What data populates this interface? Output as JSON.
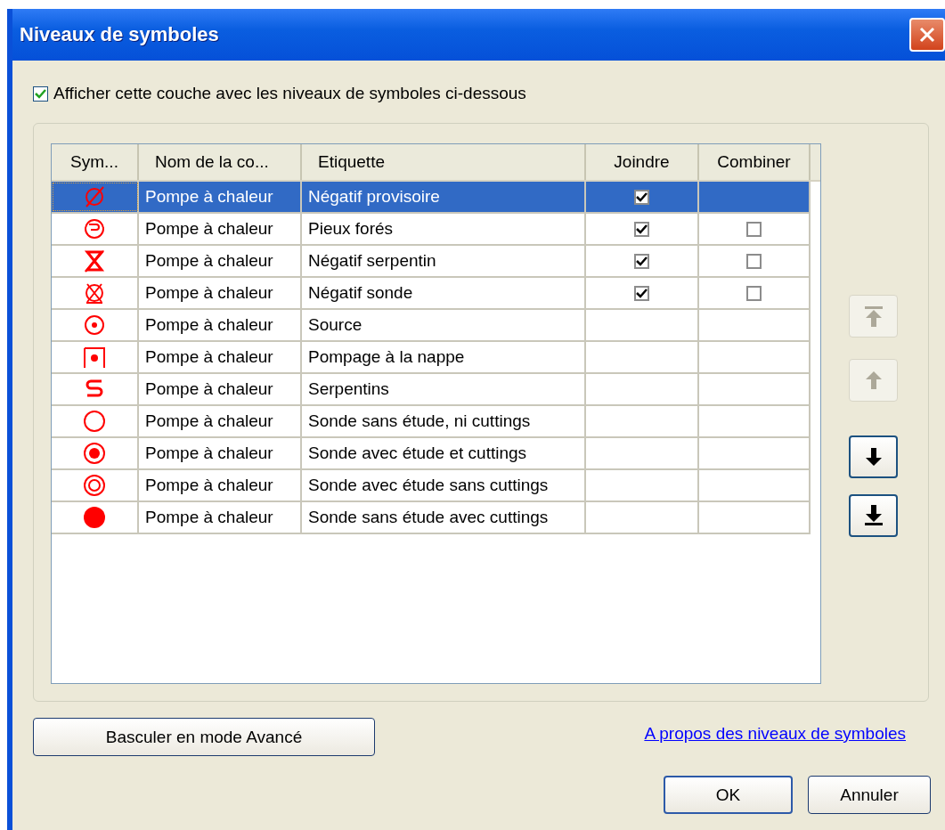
{
  "window": {
    "title": "Niveaux de symboles"
  },
  "show_layer": {
    "label": "Afficher cette couche avec les niveaux de symboles ci-dessous",
    "checked": true
  },
  "table": {
    "columns": [
      "Sym...",
      "Nom de la co...",
      "Etiquette",
      "Joindre",
      "Combiner"
    ],
    "rows": [
      {
        "kind": "slashed-circle",
        "name": "Pompe à chaleur",
        "label": "Négatif provisoire",
        "joindre": true,
        "selected": true
      },
      {
        "kind": "hook-circle",
        "name": "Pompe à chaleur",
        "label": "Pieux forés",
        "joindre": true,
        "combiner": false,
        "selected": false
      },
      {
        "kind": "crossed-hourglass",
        "name": "Pompe à chaleur",
        "label": "Négatif serpentin",
        "joindre": true,
        "combiner": false,
        "selected": false
      },
      {
        "kind": "crossed-circle",
        "name": "Pompe à chaleur",
        "label": "Négatif sonde",
        "joindre": true,
        "combiner": false,
        "selected": false
      },
      {
        "kind": "dot-circle",
        "name": "Pompe à chaleur",
        "label": "Source",
        "selected": false
      },
      {
        "kind": "dot-square",
        "name": "Pompe à chaleur",
        "label": "Pompage à la nappe",
        "selected": false
      },
      {
        "kind": "s-curve",
        "name": "Pompe à chaleur",
        "label": "Serpentins",
        "selected": false
      },
      {
        "kind": "circle",
        "name": "Pompe à chaleur",
        "label": "Sonde sans étude, ni cuttings",
        "selected": false
      },
      {
        "kind": "filled-dot-circle",
        "name": "Pompe à chaleur",
        "label": "Sonde avec étude et cuttings",
        "selected": false
      },
      {
        "kind": "double-circle",
        "name": "Pompe à chaleur",
        "label": "Sonde avec étude sans cuttings",
        "selected": false
      },
      {
        "kind": "filled-circle",
        "name": "Pompe à chaleur",
        "label": "Sonde sans étude avec cuttings",
        "selected": false
      }
    ]
  },
  "move_buttons": [
    {
      "kind": "top",
      "disabled": true
    },
    {
      "kind": "up",
      "disabled": true
    },
    {
      "kind": "down",
      "disabled": false
    },
    {
      "kind": "bottom",
      "disabled": false
    }
  ],
  "advanced_button": "Basculer en mode Avancé",
  "help_link": "A propos des niveaux de symboles",
  "buttons": [
    {
      "label": "OK",
      "default": true
    },
    {
      "label": "Annuler",
      "default": false
    }
  ]
}
